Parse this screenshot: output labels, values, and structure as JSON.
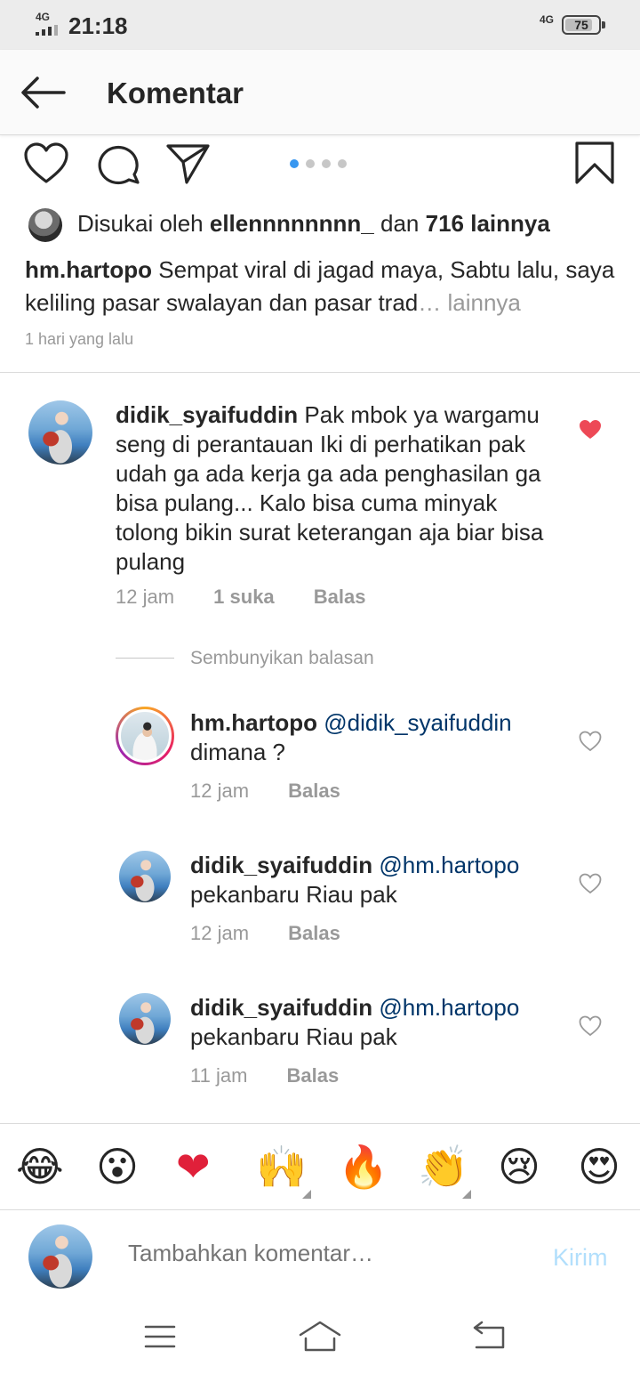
{
  "status_bar": {
    "network_left": "4G",
    "time": "21:18",
    "network_right": "4G",
    "battery": "75"
  },
  "header": {
    "title": "Komentar"
  },
  "post": {
    "carousel_pages": 4,
    "carousel_active": 1,
    "likes": {
      "prefix": "Disukai oleh",
      "user": "ellennnnnnnn_",
      "middle": "dan",
      "count": "716 lainnya"
    },
    "caption": {
      "user": "hm.hartopo",
      "text": "Sempat viral di jagad maya, Sabtu lalu, saya keliling pasar swalayan dan pasar trad",
      "ellipsis": "…",
      "more": "lainnya"
    },
    "time": "1 hari yang lalu"
  },
  "comments": [
    {
      "user": "didik_syaifuddin",
      "text": "Pak mbok ya wargamu seng di perantauan Iki di perhatikan pak udah ga ada kerja ga ada penghasilan ga bisa pulang... Kalo bisa cuma minyak tolong bikin surat keterangan aja biar bisa pulang",
      "time": "12 jam",
      "likes": "1 suka",
      "reply": "Balas",
      "liked": true
    }
  ],
  "hide_replies": "Sembunyikan balasan",
  "replies": [
    {
      "user": "hm.hartopo",
      "mention": "@didik_syaifuddin",
      "text": "dimana ?",
      "time": "12 jam",
      "reply": "Balas"
    },
    {
      "user": "didik_syaifuddin",
      "mention": "@hm.hartopo",
      "text": "pekanbaru Riau pak",
      "time": "12 jam",
      "reply": "Balas"
    },
    {
      "user": "didik_syaifuddin",
      "mention": "@hm.hartopo",
      "text": "pekanbaru Riau pak",
      "time": "11 jam",
      "reply": "Balas"
    }
  ],
  "emoji_bar": {
    "emojis": [
      "😂",
      "😮",
      "❤",
      "🙌",
      "🔥",
      "👏",
      "😢",
      "😍"
    ]
  },
  "composer": {
    "placeholder": "Tambahkan komentar…",
    "send": "Kirim"
  },
  "colors": {
    "accent": "#3897f0",
    "heart_liked": "#ed4956",
    "mention": "#003569",
    "send_disabled": "#b2dffc"
  }
}
